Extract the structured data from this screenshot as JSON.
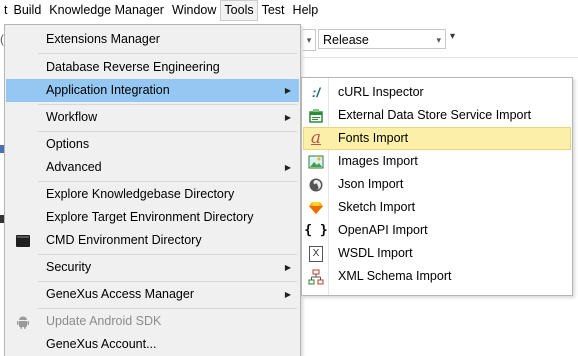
{
  "menubar": {
    "items": [
      {
        "label": "t"
      },
      {
        "label": "Build"
      },
      {
        "label": "Knowledge Manager"
      },
      {
        "label": "Window"
      },
      {
        "label": "Tools"
      },
      {
        "label": "Test"
      },
      {
        "label": "Help"
      }
    ]
  },
  "toolbar": {
    "left_fragment": "(",
    "config_combo_value": "Release",
    "combo_arrow": "▾",
    "overflow": "▾"
  },
  "tools_menu": {
    "items": [
      {
        "label": "Extensions Manager"
      },
      {
        "label": "Database Reverse Engineering"
      },
      {
        "label": "Application Integration",
        "submenu": true,
        "highlighted": true
      },
      {
        "label": "Workflow",
        "submenu": true
      },
      {
        "label": "Options"
      },
      {
        "label": "Advanced",
        "submenu": true
      },
      {
        "label": "Explore Knowledgebase Directory"
      },
      {
        "label": "Explore Target Environment Directory"
      },
      {
        "label": "CMD Environment Directory",
        "icon": "cmd-icon"
      },
      {
        "label": "Security",
        "submenu": true
      },
      {
        "label": "GeneXus Access Manager",
        "submenu": true
      },
      {
        "label": "Update Android SDK",
        "icon": "android-icon",
        "disabled": true
      },
      {
        "label": "GeneXus Account..."
      }
    ],
    "submenu_arrow": "▶"
  },
  "integration_submenu": {
    "items": [
      {
        "label": "cURL Inspector",
        "icon": "curl-icon"
      },
      {
        "label": "External Data Store Service Import",
        "icon": "datastore-icon"
      },
      {
        "label": "Fonts Import",
        "icon": "font-icon",
        "highlighted": true
      },
      {
        "label": "Images Import",
        "icon": "image-icon"
      },
      {
        "label": "Json Import",
        "icon": "json-icon"
      },
      {
        "label": "Sketch Import",
        "icon": "sketch-icon"
      },
      {
        "label": "OpenAPI Import",
        "icon": "openapi-braces-icon"
      },
      {
        "label": "WSDL Import",
        "icon": "wsdl-icon"
      },
      {
        "label": "XML Schema Import",
        "icon": "xml-schema-icon"
      }
    ],
    "glyphs": {
      "curl": ":/",
      "font": "a",
      "openapi": "{ }",
      "wsdl": "X"
    }
  },
  "colors": {
    "menu_highlight": "#94c7f1",
    "submenu_highlight": "#fcefa8",
    "menu_background": "#f0f0f0"
  }
}
